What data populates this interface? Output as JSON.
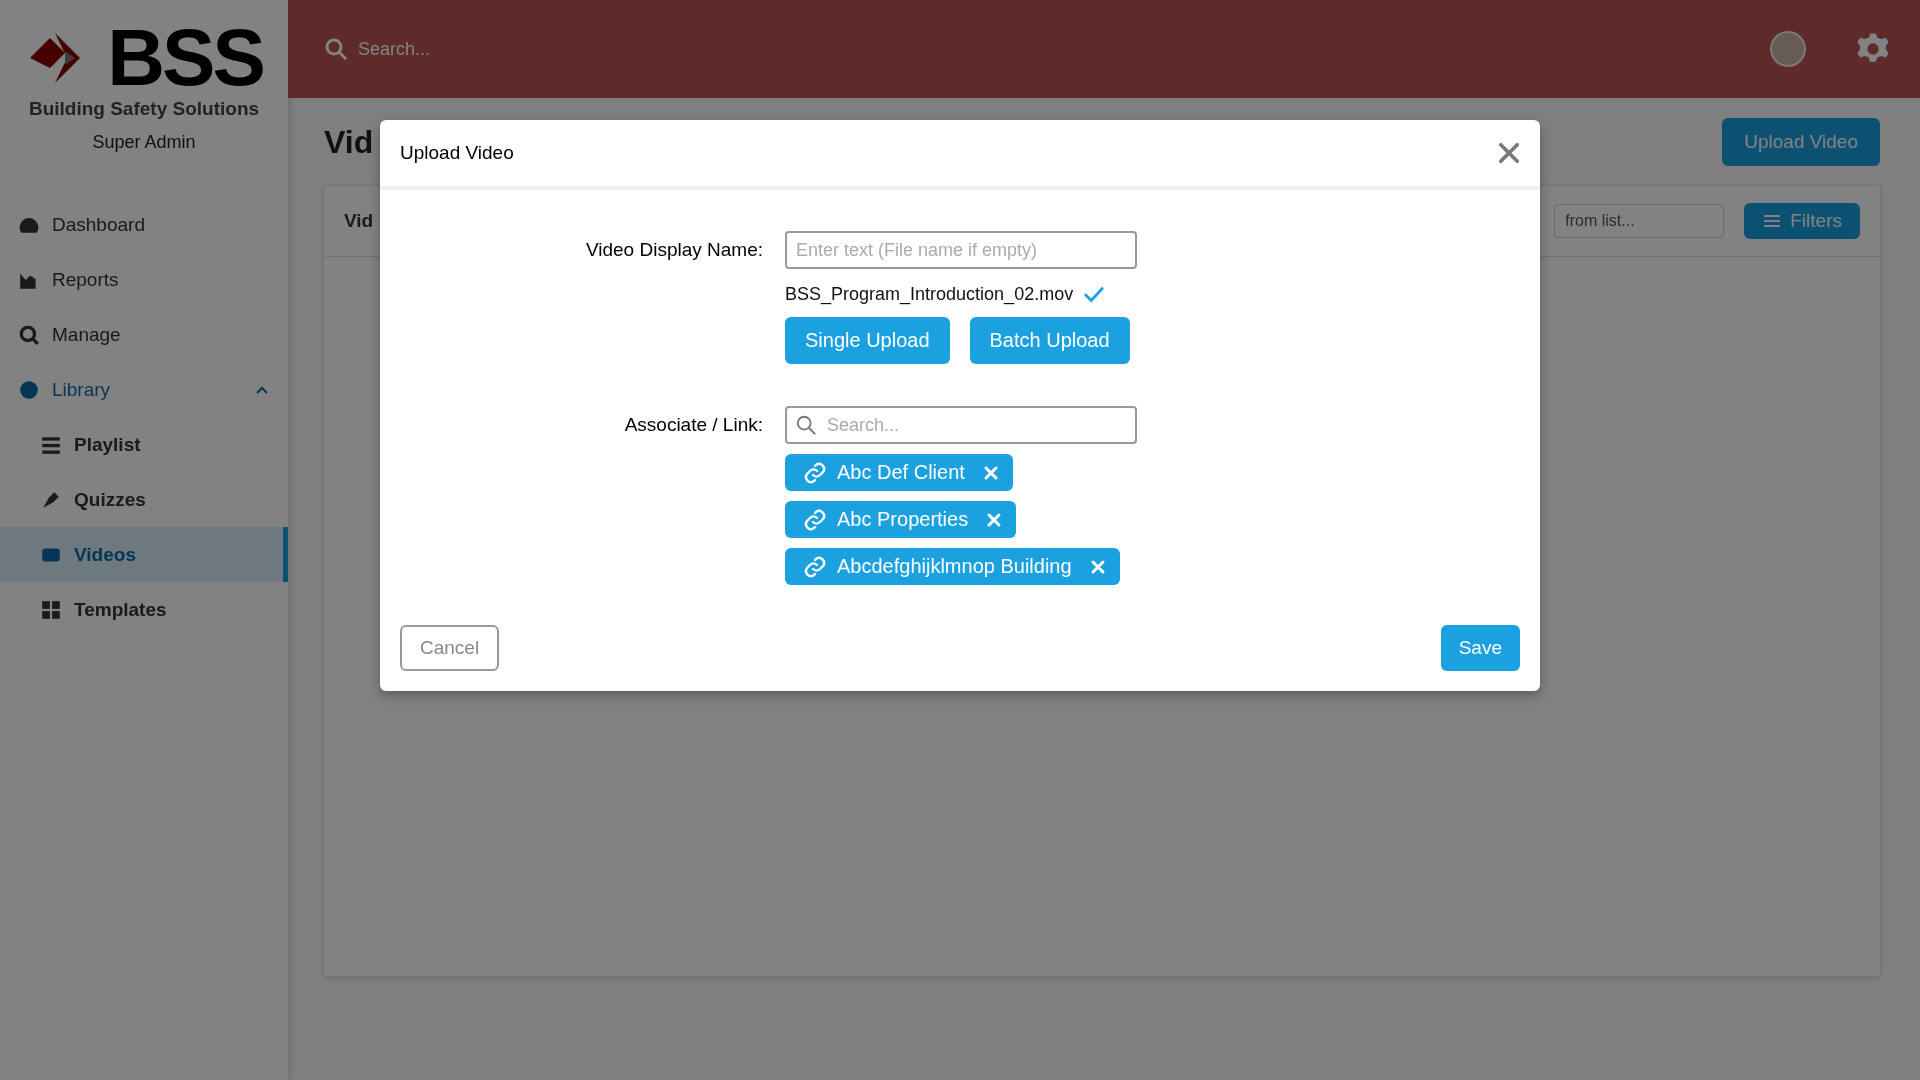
{
  "sidebar": {
    "logo_text": "BSS",
    "logo_subtitle": "Building Safety Solutions",
    "role": "Super Admin",
    "items": [
      {
        "label": "Dashboard",
        "selected": false
      },
      {
        "label": "Reports",
        "selected": false
      },
      {
        "label": "Manage",
        "selected": false
      },
      {
        "label": "Library",
        "selected": false,
        "expanded": true,
        "children": [
          {
            "label": "Playlist",
            "selected": false
          },
          {
            "label": "Quizzes",
            "selected": false
          },
          {
            "label": "Videos",
            "selected": true
          },
          {
            "label": "Templates",
            "selected": false
          }
        ]
      }
    ]
  },
  "topbar": {
    "search_placeholder": "Search..."
  },
  "page": {
    "title": "Vid",
    "upload_button": "Upload Video",
    "card_title": "Vid",
    "filter_placeholder": "from list...",
    "filters_button": "Filters"
  },
  "dialog": {
    "title": "Upload Video",
    "display_name_label": "Video Display Name:",
    "display_name_placeholder": "Enter text (File name if empty)",
    "file_name": "BSS_Program_Introduction_02.mov",
    "file_verified": true,
    "upload_buttons": [
      "Single Upload",
      "Batch Upload"
    ],
    "associate_label": "Associate / Link:",
    "associate_placeholder": "Search...",
    "links": [
      "Abc Def Client",
      "Abc Properties",
      "Abcdefghijklmnop Building"
    ],
    "cancel": "Cancel",
    "save": "Save"
  }
}
